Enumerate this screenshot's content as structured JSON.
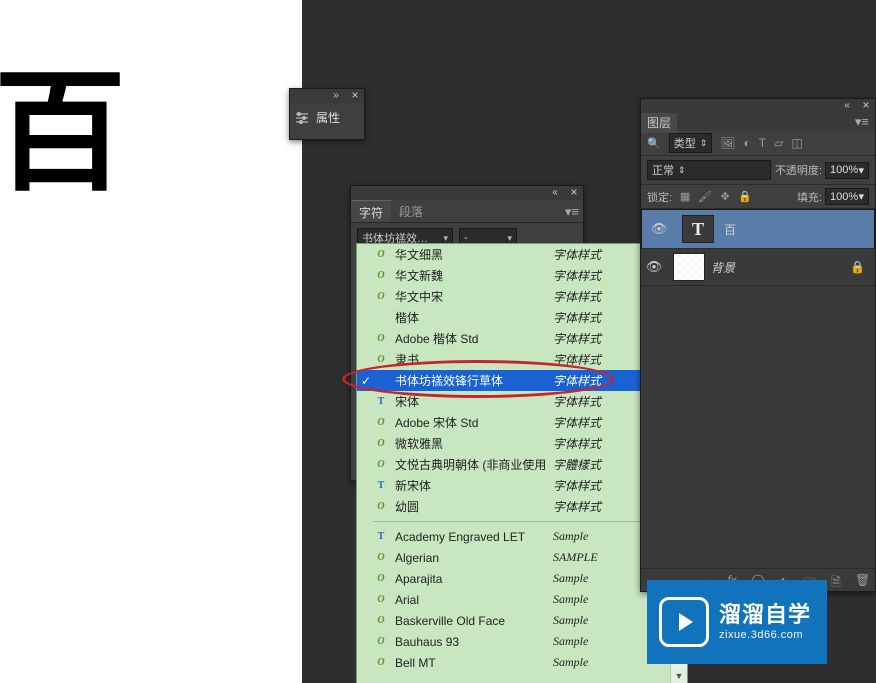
{
  "canvas": {
    "char": "百"
  },
  "properties_panel": {
    "title": "属性"
  },
  "char_panel": {
    "tab_char": "字符",
    "tab_para": "段落",
    "font_display": "书体坊禚效…",
    "style_display": "-"
  },
  "font_list": {
    "sample_cjk": "字体样式",
    "sample_trad": "字體樣式",
    "sample_en": "Sample",
    "sample_en_caps": "SAMPLE",
    "items_cjk": [
      {
        "t": "o",
        "name": "华文细黑",
        "sample": "字体样式"
      },
      {
        "t": "o",
        "name": "华文新魏",
        "sample": "字体样式"
      },
      {
        "t": "o",
        "name": "华文中宋",
        "sample": "字体样式"
      },
      {
        "t": "",
        "name": "楷体",
        "sample": "字体样式"
      },
      {
        "t": "o",
        "name": "Adobe 楷体 Std",
        "sample": "字体样式"
      },
      {
        "t": "o",
        "name": "隶书",
        "sample": "字体样式"
      },
      {
        "t": "t",
        "name": "书体坊禚效锋行草体",
        "sample": "字体样式",
        "selected": true
      },
      {
        "t": "t",
        "name": "宋体",
        "sample": "字体样式"
      },
      {
        "t": "o",
        "name": "Adobe 宋体 Std",
        "sample": "字体样式"
      },
      {
        "t": "o",
        "name": "微软雅黑",
        "sample": "字体样式"
      },
      {
        "t": "o",
        "name": "文悦古典明朝体 (非商业使用)",
        "sample": "字體樣式"
      },
      {
        "t": "t",
        "name": "新宋体",
        "sample": "字体样式"
      },
      {
        "t": "o",
        "name": "幼圆",
        "sample": "字体样式"
      }
    ],
    "items_en": [
      {
        "t": "t",
        "name": "Academy Engraved LET",
        "sample": "Sample"
      },
      {
        "t": "o",
        "name": "Algerian",
        "sample": "SAMPLE"
      },
      {
        "t": "o",
        "name": "Aparajita",
        "sample": "Sample"
      },
      {
        "t": "o",
        "name": "Arial",
        "sample": "Sample"
      },
      {
        "t": "o",
        "name": "Baskerville Old Face",
        "sample": "Sample"
      },
      {
        "t": "o",
        "name": "Bauhaus 93",
        "sample": "Sample"
      },
      {
        "t": "o",
        "name": "Bell MT",
        "sample": "Sample"
      }
    ]
  },
  "layers_panel": {
    "tab": "图层",
    "filter_label": "类型",
    "blend_mode": "正常",
    "opacity_label": "不透明度:",
    "opacity_value": "100%",
    "fill_label": "填充:",
    "fill_value": "100%",
    "lock_label": "锁定:",
    "layer_text": {
      "name": "百"
    },
    "layer_bg": {
      "name": "背景"
    }
  },
  "watermark": {
    "title": "溜溜自学",
    "url": "zixue.3d66.com"
  }
}
